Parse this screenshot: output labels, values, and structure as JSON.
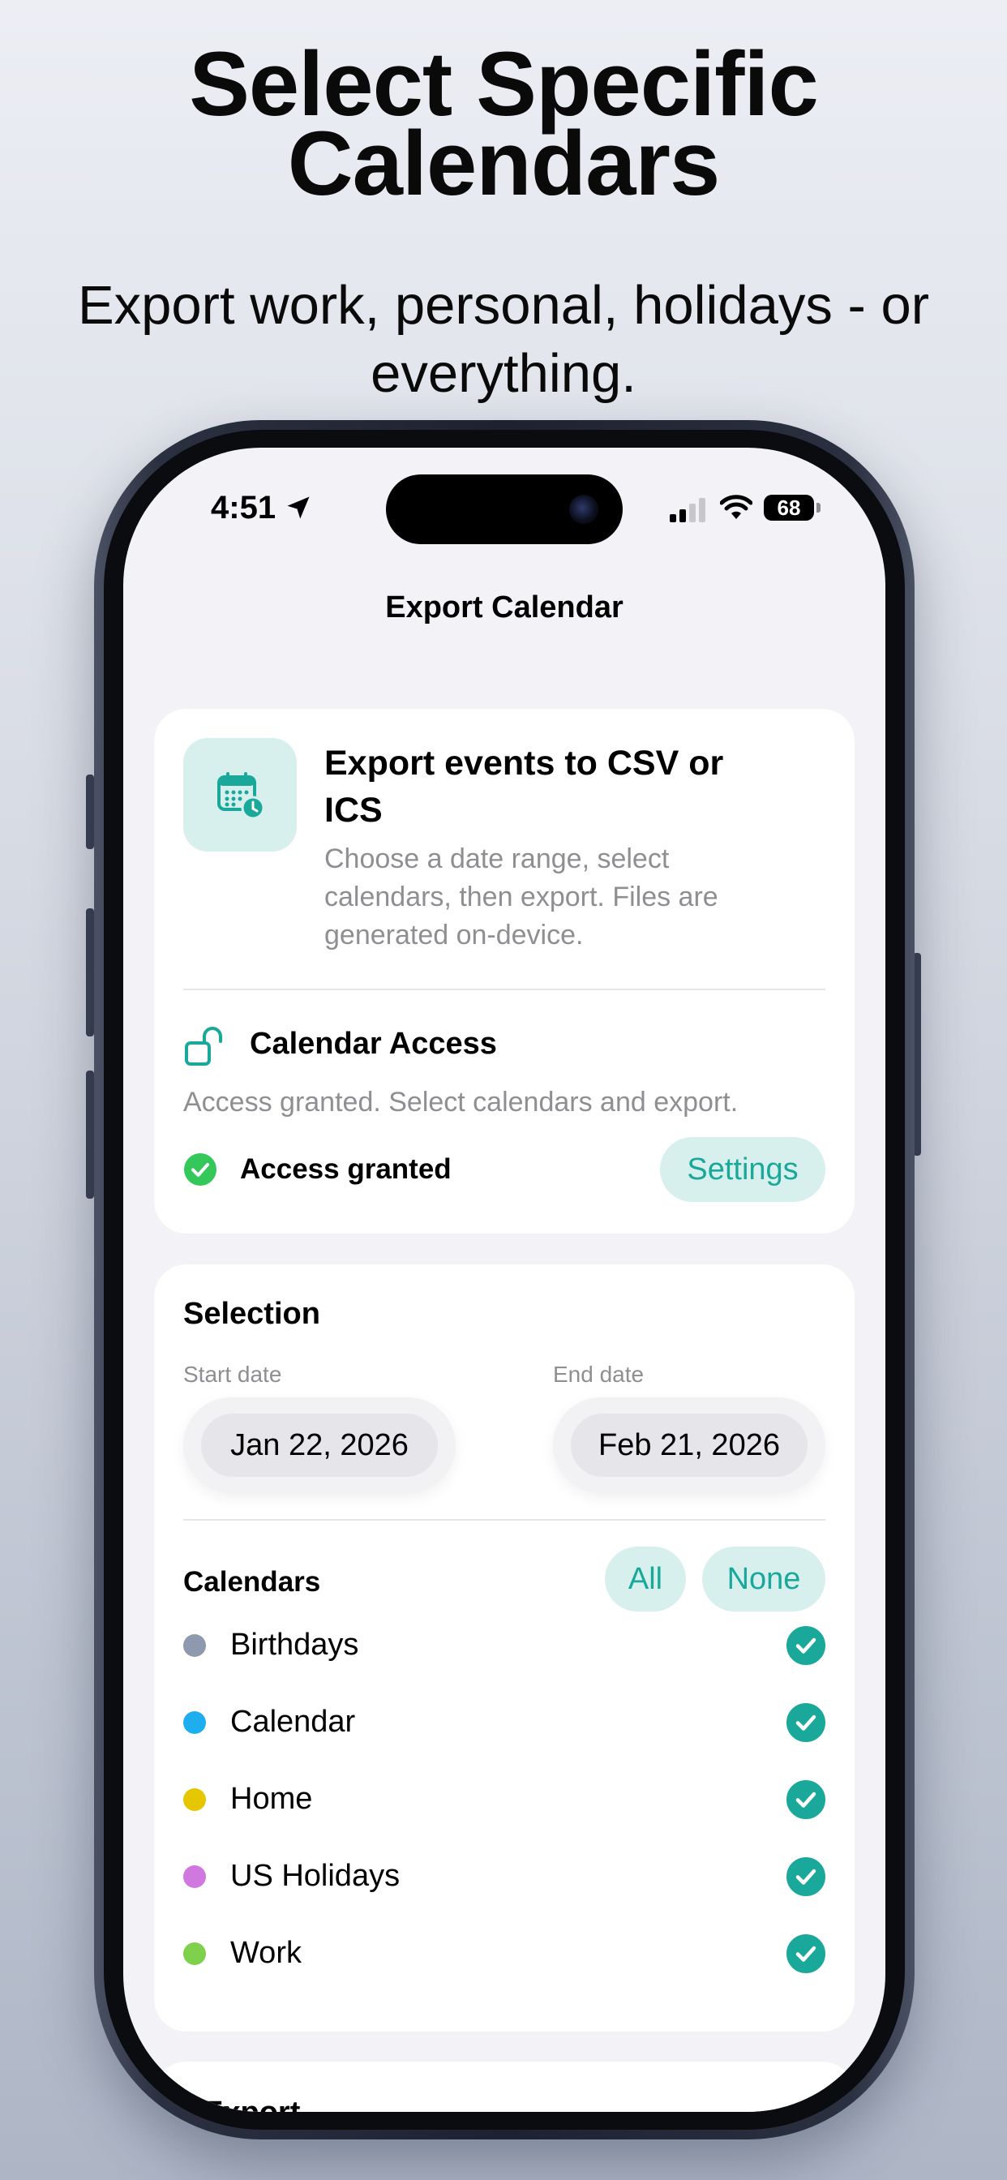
{
  "promo": {
    "headline_line1": "Select Specific",
    "headline_line2": "Calendars",
    "subline": "Export work, personal, holidays - or everything."
  },
  "status_bar": {
    "time": "4:51",
    "battery": "68"
  },
  "nav": {
    "title": "Export Calendar"
  },
  "intro_card": {
    "title": "Export events to CSV or ICS",
    "description": "Choose a date range, select calendars, then export. Files are generated on-device."
  },
  "access": {
    "title": "Calendar Access",
    "description": "Access granted. Select calendars and export.",
    "status": "Access granted",
    "settings_label": "Settings"
  },
  "selection": {
    "title": "Selection",
    "start_label": "Start date",
    "start_value": "Jan 22, 2026",
    "end_label": "End date",
    "end_value": "Feb 21, 2026",
    "calendars_label": "Calendars",
    "all_label": "All",
    "none_label": "None",
    "calendars": [
      {
        "name": "Birthdays",
        "color": "#8e99b0",
        "checked": true
      },
      {
        "name": "Calendar",
        "color": "#1eaef0",
        "checked": true
      },
      {
        "name": "Home",
        "color": "#e6c600",
        "checked": true
      },
      {
        "name": "US Holidays",
        "color": "#d178e0",
        "checked": true
      },
      {
        "name": "Work",
        "color": "#7ed04d",
        "checked": true
      }
    ]
  },
  "export_card": {
    "title": "Export"
  },
  "colors": {
    "accent": "#1aa89a",
    "accent_bg": "#d7f0ee",
    "success": "#34c759"
  }
}
